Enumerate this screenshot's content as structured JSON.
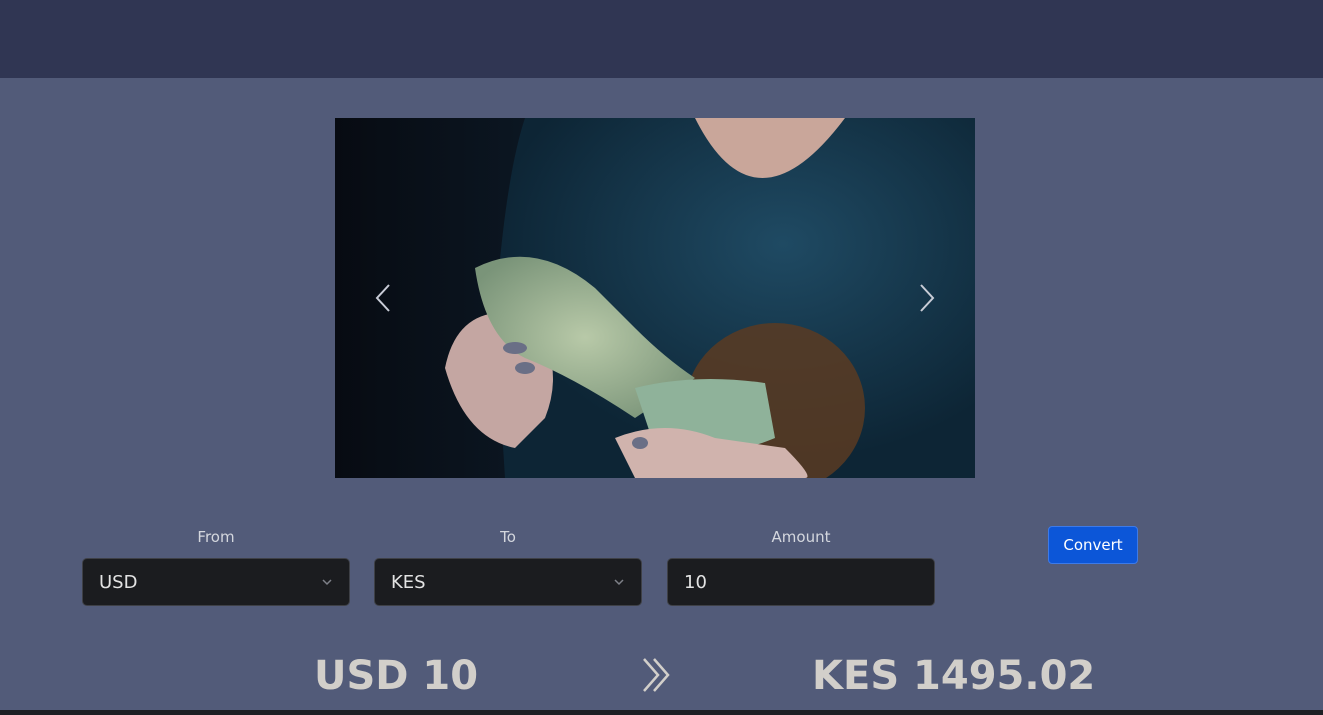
{
  "form": {
    "from_label": "From",
    "to_label": "To",
    "amount_label": "Amount",
    "from_value": "USD",
    "to_value": "KES",
    "amount_value": "10",
    "convert_label": "Convert"
  },
  "result": {
    "from_text": "USD 10",
    "to_text": "KES 1495.02"
  },
  "carousel": {
    "prev_icon": "chevron-left-icon",
    "next_icon": "chevron-right-icon",
    "image_subject": ""
  },
  "colors": {
    "page_bg": "#525b79",
    "header_bg": "#303653",
    "accent": "#0c56d8",
    "input_bg": "#1b1c1f"
  }
}
